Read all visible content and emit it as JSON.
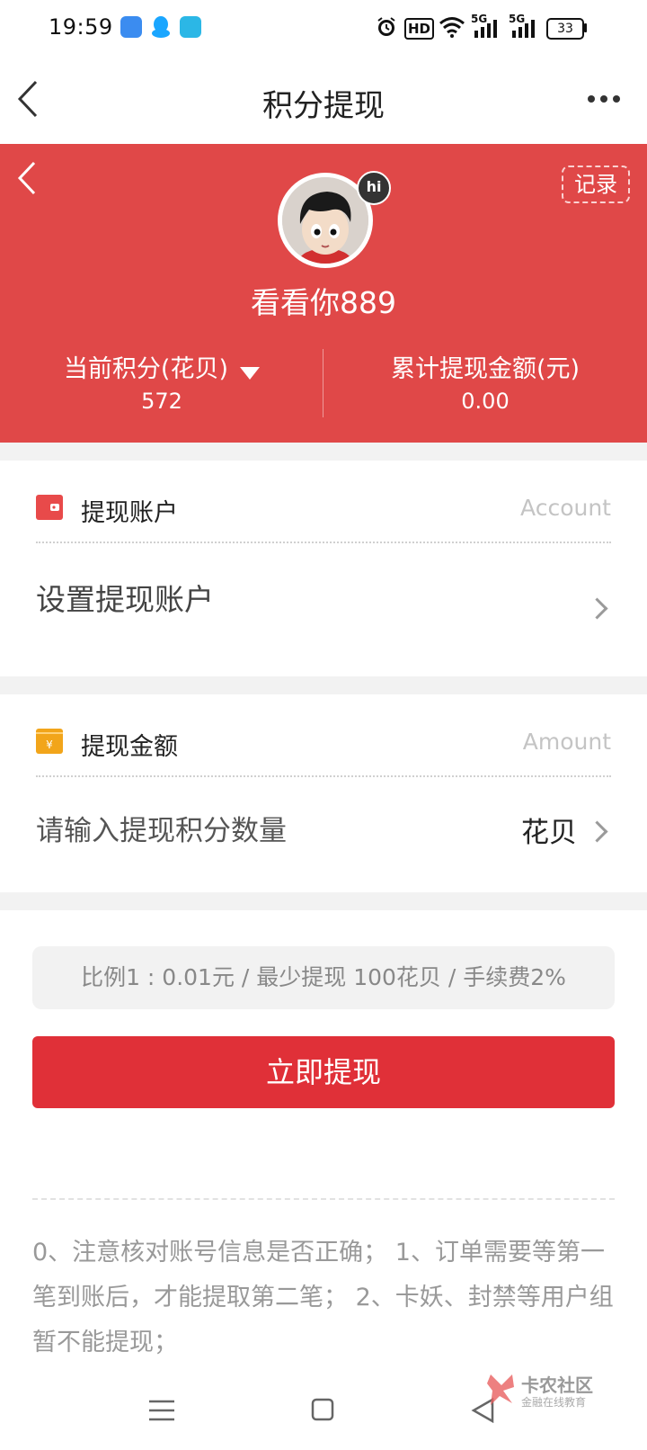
{
  "status_bar": {
    "time": "19:59",
    "battery": "33",
    "net_hd": "HD",
    "net_5g_1": "5G",
    "net_5g_2": "5G"
  },
  "header": {
    "title": "积分提现"
  },
  "profile": {
    "username": "看看你889",
    "hi_badge": "hi",
    "record_label": "记录",
    "points_label": "当前积分(花贝)",
    "points_value": "572",
    "total_label": "累计提现金额(元)",
    "total_value": "0.00"
  },
  "account_section": {
    "label": "提现账户",
    "hint": "Account",
    "action": "设置提现账户"
  },
  "amount_section": {
    "label": "提现金额",
    "hint": "Amount",
    "placeholder": "请输入提现积分数量",
    "unit": "花贝"
  },
  "ratio_text": "比例1 : 0.01元 / 最少提现 100花贝 / 手续费2%",
  "submit_label": "立即提现",
  "notice_text": "0、注意核对账号信息是否正确； 1、订单需要等第一笔到账后，才能提取第二笔； 2、卡妖、封禁等用户组暂不能提现；",
  "watermark": {
    "name": "卡农社区",
    "sub": "金融在线教育"
  },
  "colors": {
    "hero": "#e04848",
    "button": "#e03038"
  }
}
